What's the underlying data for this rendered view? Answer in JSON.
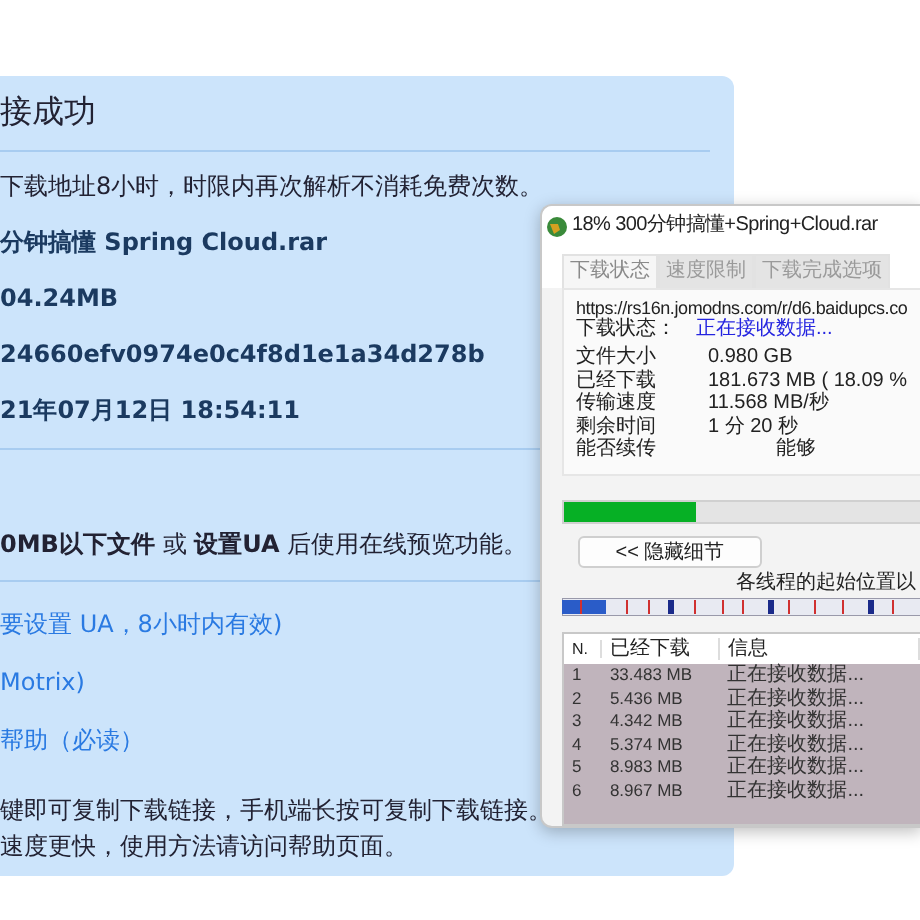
{
  "result_card": {
    "title": "接成功",
    "notice": "下载地址8小时，时限内再次解析不消耗免费次数。",
    "file_lines": [
      "分钟搞懂 Spring Cloud.rar",
      "04.24MB",
      "24660efv0974e0c4f8d1e1a34d278b",
      "21年07月12日 18:54:11"
    ],
    "preview_note": "**0MB以下文件** 或 **设置UA** 后使用在线预览功能。",
    "links": [
      "要设置 UA，8小时内有效)",
      "Motrix)",
      "帮助（必读）"
    ],
    "tips": [
      "键即可复制下载链接，手机端长按可复制下载链接。",
      "速度更快，使用方法请访问帮助页面。"
    ]
  },
  "download_window": {
    "title": "18% 300分钟搞懂+Spring+Cloud.rar",
    "tabs": [
      {
        "label": "下载状态",
        "selected": true
      },
      {
        "label": "速度限制",
        "selected": false
      },
      {
        "label": "下载完成选项",
        "selected": false
      }
    ],
    "url": "https://rs16n.jomodns.com/r/d6.baidupcs.co",
    "status_label": "下载状态：",
    "status_value": "正在接收数据...",
    "details": [
      {
        "label": "文件大小",
        "value": "0.980  GB"
      },
      {
        "label": "已经下载",
        "value": "181.673  MB  ( 18.09 %"
      },
      {
        "label": "传输速度",
        "value": "11.568  MB/秒"
      },
      {
        "label": "剩余时间",
        "value": "1 分 20 秒"
      },
      {
        "label": "能否续传",
        "value": "能够"
      }
    ],
    "progress": {
      "level": 0.37
    },
    "toggle_button": "<< 隐藏细节",
    "threads_caption": "各线程的起始位置以",
    "table": {
      "columns": [
        "N.",
        "已经下载",
        "信息"
      ],
      "rows": [
        [
          "1",
          "33.483  MB",
          "正在接收数据..."
        ],
        [
          "2",
          "5.436  MB",
          "正在接收数据..."
        ],
        [
          "3",
          "4.342  MB",
          "正在接收数据..."
        ],
        [
          "4",
          "5.374  MB",
          "正在接收数据..."
        ],
        [
          "5",
          "8.983  MB",
          "正在接收数据..."
        ],
        [
          "6",
          "8.967  MB",
          "正在接收数据..."
        ]
      ]
    }
  }
}
